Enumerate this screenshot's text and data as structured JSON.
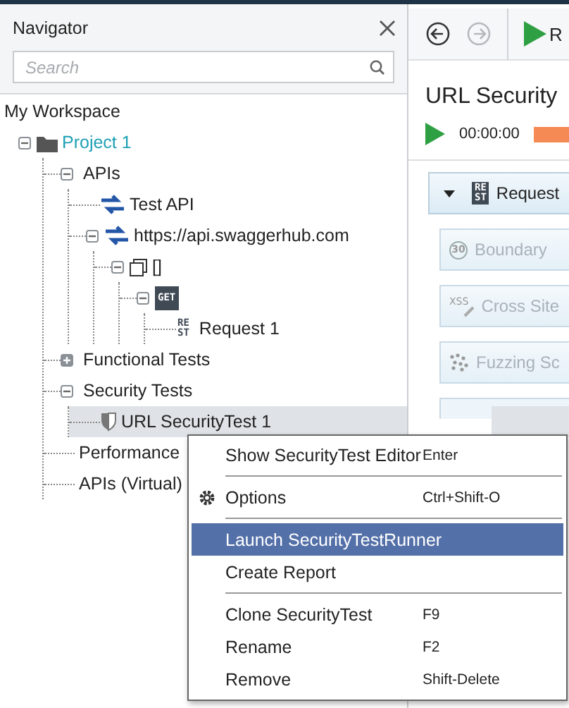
{
  "navigator": {
    "title": "Navigator",
    "search": {
      "placeholder": "Search"
    }
  },
  "tree": {
    "label": "My Workspace",
    "selected": false,
    "children": [
      {
        "label": "Project 1",
        "kind": "project",
        "expanded": true,
        "selected": false,
        "children": [
          {
            "label": "APIs",
            "expanded": true,
            "selected": false,
            "children": [
              {
                "label": "Test API",
                "kind": "api",
                "selected": false
              },
              {
                "label": "https://api.swaggerhub.com",
                "kind": "api",
                "expanded": true,
                "selected": false,
                "children": [
                  {
                    "label": "[]",
                    "kind": "resource",
                    "expanded": true,
                    "selected": false,
                    "children": [
                      {
                        "badge": "GET",
                        "kind": "method",
                        "expanded": true,
                        "selected": false,
                        "children": [
                          {
                            "label": "Request 1",
                            "badge": "RE ST",
                            "kind": "request",
                            "selected": false
                          }
                        ]
                      }
                    ]
                  }
                ]
              }
            ]
          },
          {
            "label": "Functional Tests",
            "expanded": false,
            "selected": false
          },
          {
            "label": "Security Tests",
            "expanded": true,
            "selected": false,
            "children": [
              {
                "label": "URL SecurityTest 1",
                "kind": "security_test",
                "selected": true
              }
            ]
          },
          {
            "label": "Performance",
            "selected": false
          },
          {
            "label": "APIs (Virtual)",
            "selected": false
          }
        ]
      }
    ]
  },
  "editor": {
    "back_disabled": false,
    "forward_disabled": true,
    "run_label": "R",
    "title": "URL Security",
    "timer": "00:00:00",
    "steps": [
      {
        "kind": "request",
        "badge": "RE ST",
        "label": "Request",
        "disabled": false
      },
      {
        "kind": "boundary",
        "icon_text": "30",
        "label": "Boundary",
        "disabled": true
      },
      {
        "kind": "cross_site",
        "icon_text": "XSS",
        "label": "Cross Site",
        "disabled": true
      },
      {
        "kind": "fuzzing",
        "label": "Fuzzing Sc",
        "disabled": true
      }
    ]
  },
  "context_menu": {
    "items": [
      {
        "kind": "item",
        "label": "Show SecurityTest Editor",
        "shortcut": "Enter",
        "selected": false
      },
      {
        "kind": "separator"
      },
      {
        "kind": "gear_item",
        "label": "Options",
        "shortcut": "Ctrl+Shift-O",
        "selected": false
      },
      {
        "kind": "separator"
      },
      {
        "kind": "item",
        "label": "Launch SecurityTestRunner",
        "selected": true
      },
      {
        "kind": "item",
        "label": "Create Report",
        "selected": false
      },
      {
        "kind": "separator"
      },
      {
        "kind": "item",
        "label": "Clone SecurityTest",
        "shortcut": "F9",
        "selected": false
      },
      {
        "kind": "item",
        "label": "Rename",
        "shortcut": "F2",
        "selected": false
      },
      {
        "kind": "item",
        "label": "Remove",
        "shortcut": "Shift-Delete",
        "selected": false
      }
    ]
  }
}
